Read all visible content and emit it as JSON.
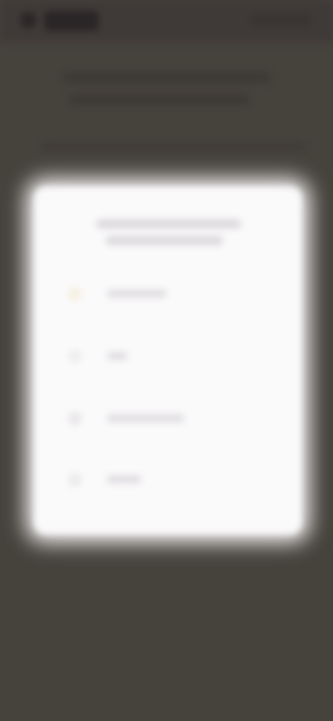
{
  "screen": {
    "overlay_color": "#46423c",
    "dialog_color": "#fbfafb"
  },
  "dialog": {
    "title": "",
    "options": [
      {
        "label": "",
        "icon": "option-icon"
      },
      {
        "label": "",
        "icon": "option-icon"
      },
      {
        "label": "",
        "icon": "option-icon"
      },
      {
        "label": "",
        "icon": "option-icon"
      }
    ]
  }
}
